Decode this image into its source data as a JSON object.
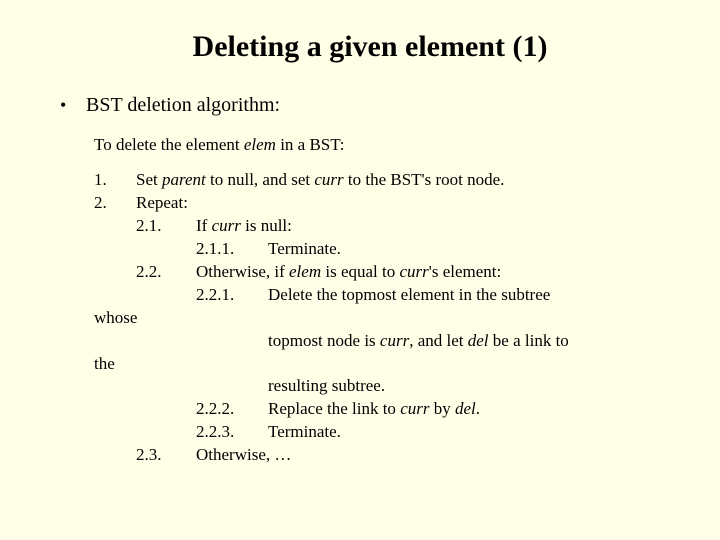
{
  "title": "Deleting a given element (1)",
  "bullet": "BST deletion algorithm:",
  "intro_a": "To delete the element ",
  "intro_elem": "elem",
  "intro_b": " in a BST:",
  "n1": "1.",
  "s1a": "Set ",
  "s1b": "parent",
  "s1c": " to null, and set ",
  "s1d": "curr",
  "s1e": " to the BST's root node.",
  "n2": "2.",
  "s2": "Repeat:",
  "n21": "2.1.",
  "s21a": "If ",
  "s21b": "curr",
  "s21c": " is null:",
  "n211": "2.1.1.",
  "s211": "Terminate.",
  "n22": "2.2.",
  "s22a": "Otherwise, if ",
  "s22b": "elem",
  "s22c": " is equal to ",
  "s22d": "curr",
  "s22e": "'s element:",
  "n221": "2.2.1.",
  "s221": "Delete the topmost element in the subtree",
  "whose": "whose",
  "cont1a": "topmost node is ",
  "cont1b": "curr",
  "cont1c": ", and let ",
  "cont1d": "del",
  "cont1e": " be a link to",
  "the": "the",
  "cont2": "resulting subtree.",
  "n222": "2.2.2.",
  "s222a": "Replace the link to ",
  "s222b": "curr",
  "s222c": " by ",
  "s222d": "del",
  "s222e": ".",
  "n223": "2.2.3.",
  "s223": "Terminate.",
  "n23": "2.3.",
  "s23": "Otherwise, …"
}
